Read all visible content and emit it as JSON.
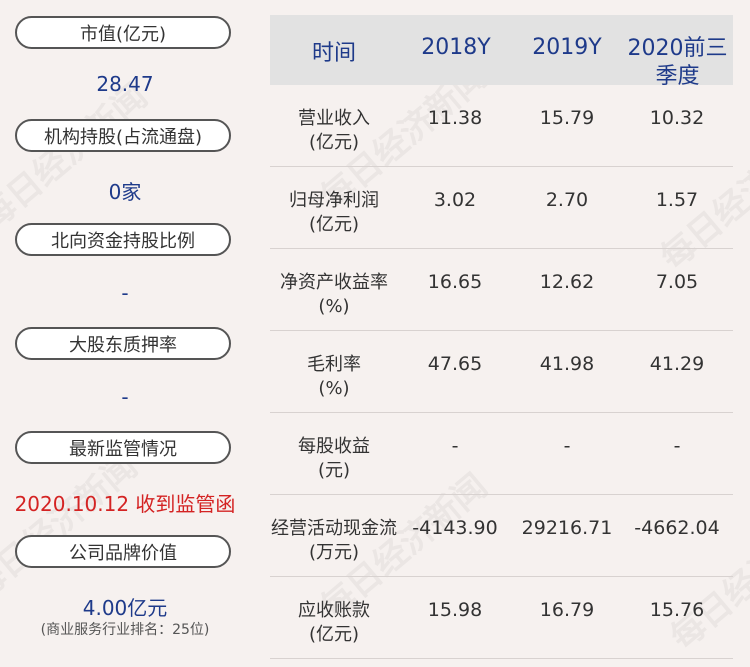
{
  "watermark_text": "每日经济新闻",
  "left_panel": {
    "items": [
      {
        "label": "市值(亿元)",
        "value": "28.47"
      },
      {
        "label": "机构持股(占流通盘)",
        "value": "0家"
      },
      {
        "label": "北向资金持股比例",
        "value": "-"
      },
      {
        "label": "大股东质押率",
        "value": "-"
      },
      {
        "label": "最新监管情况",
        "value": "2020.10.12 收到监管函"
      },
      {
        "label": "公司品牌价值",
        "value": "4.00亿元",
        "note": "(商业服务行业排名：25位)"
      }
    ]
  },
  "financial_table": {
    "headers": [
      "时间",
      "2018Y",
      "2019Y",
      "2020前三季度"
    ],
    "rows": [
      {
        "label": "营业收入",
        "unit": "(亿元)",
        "values": [
          "11.38",
          "15.79",
          "10.32"
        ]
      },
      {
        "label": "归母净利润",
        "unit": "(亿元)",
        "values": [
          "3.02",
          "2.70",
          "1.57"
        ]
      },
      {
        "label": "净资产收益率",
        "unit": "(%)",
        "values": [
          "16.65",
          "12.62",
          "7.05"
        ]
      },
      {
        "label": "毛利率",
        "unit": "(%)",
        "values": [
          "47.65",
          "41.98",
          "41.29"
        ]
      },
      {
        "label": "每股收益",
        "unit": "(元)",
        "values": [
          "-",
          "-",
          "-"
        ]
      },
      {
        "label": "经营活动现金流",
        "unit": "(万元)",
        "values": [
          "-4143.90",
          "29216.71",
          "-4662.04"
        ]
      },
      {
        "label": "应收账款",
        "unit": "(亿元)",
        "values": [
          "15.98",
          "16.79",
          "15.76"
        ]
      }
    ]
  },
  "colors": {
    "background": "#f6f1ef",
    "value_blue": "#1e3a8a",
    "alert_red": "#d42323",
    "header_gray": "#e2e2e2"
  }
}
